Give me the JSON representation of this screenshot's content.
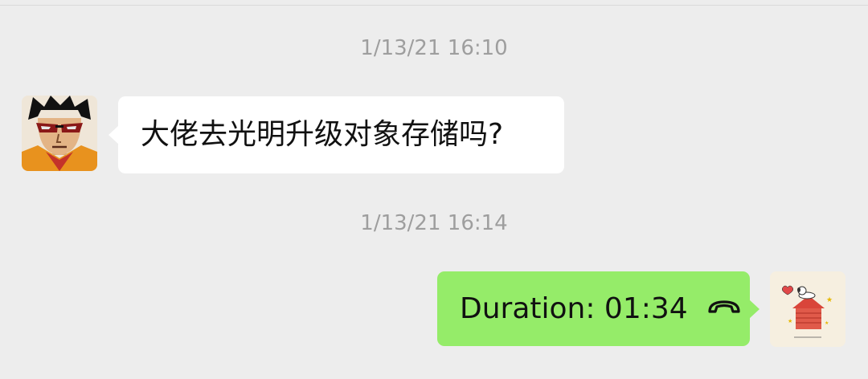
{
  "messages": [
    {
      "timestamp": "1/13/21 16:10",
      "sender": "other",
      "text": "大佬去光明升级对象存储吗?",
      "avatar_icon": "cartoon-man-sunglasses-avatar"
    },
    {
      "timestamp": "1/13/21 16:14",
      "sender": "self",
      "text": "Duration: 01:34",
      "icon": "hang-up-phone-icon",
      "avatar_icon": "snoopy-doghouse-avatar"
    }
  ],
  "colors": {
    "background": "#ededed",
    "incoming_bubble": "#ffffff",
    "outgoing_bubble": "#95ec69",
    "timestamp_text": "#9e9e9e"
  }
}
